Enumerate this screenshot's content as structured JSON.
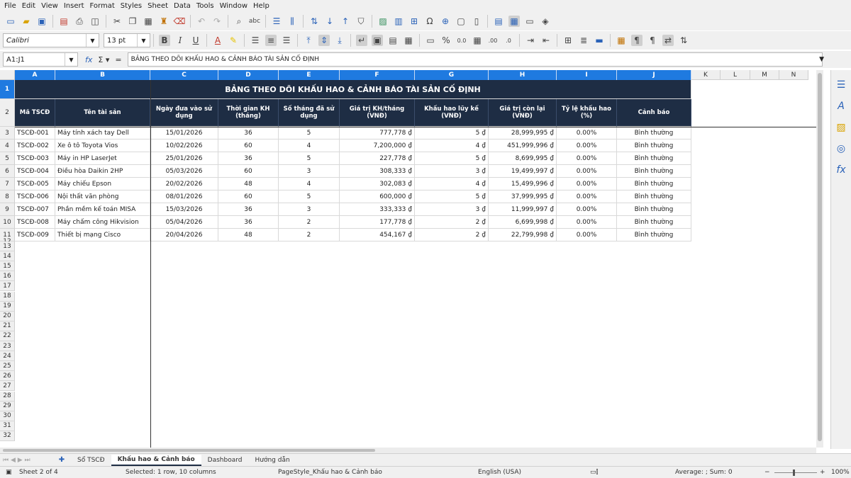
{
  "menu": [
    "File",
    "Edit",
    "View",
    "Insert",
    "Format",
    "Styles",
    "Sheet",
    "Data",
    "Tools",
    "Window",
    "Help"
  ],
  "toolbar2": {
    "font_name": "Calibri",
    "font_size": "13 pt"
  },
  "formula": {
    "cell_ref": "A1:J1",
    "content": "BẢNG THEO DÕI KHẤU HAO & CẢNH BÁO TÀI SẢN CỐ ĐỊNH"
  },
  "columns": [
    "A",
    "B",
    "C",
    "D",
    "E",
    "F",
    "G",
    "H",
    "I",
    "J",
    "K",
    "L",
    "M",
    "N"
  ],
  "rows_numbers": [
    "1",
    "2",
    "3",
    "4",
    "5",
    "6",
    "7",
    "8",
    "9",
    "10",
    "11",
    "12",
    "13",
    "14",
    "15",
    "16",
    "17",
    "18",
    "19",
    "20",
    "21",
    "22",
    "23",
    "24",
    "25",
    "26",
    "27",
    "28",
    "29",
    "30",
    "31",
    "32"
  ],
  "sheet": {
    "title": "BẢNG THEO DÕI KHẤU HAO & CẢNH BÁO TÀI SẢN CỐ ĐỊNH",
    "headers": [
      "Mã TSCĐ",
      "Tên tài sản",
      "Ngày đưa vào sử dụng",
      "Thời gian KH (tháng)",
      "Số tháng đã sử dụng",
      "Giá trị KH/tháng (VNĐ)",
      "Khấu hao lũy kế (VNĐ)",
      "Giá trị còn lại (VNĐ)",
      "Tỷ lệ khấu hao (%)",
      "Cảnh báo"
    ],
    "rows": [
      [
        "TSCĐ-001",
        "Máy tính xách tay Dell",
        "15/01/2026",
        "36",
        "5",
        "777,778 ₫",
        "5 ₫",
        "28,999,995 ₫",
        "0.00%",
        "Bình thường"
      ],
      [
        "TSCĐ-002",
        "Xe ô tô Toyota Vios",
        "10/02/2026",
        "60",
        "4",
        "7,200,000 ₫",
        "4 ₫",
        "451,999,996 ₫",
        "0.00%",
        "Bình thường"
      ],
      [
        "TSCĐ-003",
        "Máy in HP LaserJet",
        "25/01/2026",
        "36",
        "5",
        "227,778 ₫",
        "5 ₫",
        "8,699,995 ₫",
        "0.00%",
        "Bình thường"
      ],
      [
        "TSCĐ-004",
        "Điều hòa Daikin 2HP",
        "05/03/2026",
        "60",
        "3",
        "308,333 ₫",
        "3 ₫",
        "19,499,997 ₫",
        "0.00%",
        "Bình thường"
      ],
      [
        "TSCĐ-005",
        "Máy chiếu Epson",
        "20/02/2026",
        "48",
        "4",
        "302,083 ₫",
        "4 ₫",
        "15,499,996 ₫",
        "0.00%",
        "Bình thường"
      ],
      [
        "TSCĐ-006",
        "Nội thất văn phòng",
        "08/01/2026",
        "60",
        "5",
        "600,000 ₫",
        "5 ₫",
        "37,999,995 ₫",
        "0.00%",
        "Bình thường"
      ],
      [
        "TSCĐ-007",
        "Phần mềm kế toán MISA",
        "15/03/2026",
        "36",
        "3",
        "333,333 ₫",
        "3 ₫",
        "11,999,997 ₫",
        "0.00%",
        "Bình thường"
      ],
      [
        "TSCĐ-008",
        "Máy chấm công Hikvision",
        "05/04/2026",
        "36",
        "2",
        "177,778 ₫",
        "2 ₫",
        "6,699,998 ₫",
        "0.00%",
        "Bình thường"
      ],
      [
        "TSCĐ-009",
        "Thiết bị mạng Cisco",
        "20/04/2026",
        "48",
        "2",
        "454,167 ₫",
        "2 ₫",
        "22,799,998 ₫",
        "0.00%",
        "Bình thường"
      ]
    ]
  },
  "tabs": [
    "Sổ TSCĐ",
    "Khấu hao & Cảnh báo",
    "Dashboard",
    "Hướng dẫn"
  ],
  "status": {
    "sheet": "Sheet 2 of 4",
    "selection": "Selected: 1 row, 10 columns",
    "page_style": "PageStyle_Khấu hao & Cảnh báo",
    "language": "English (USA)",
    "summary": "Average: ; Sum: 0",
    "zoom": "100%"
  }
}
